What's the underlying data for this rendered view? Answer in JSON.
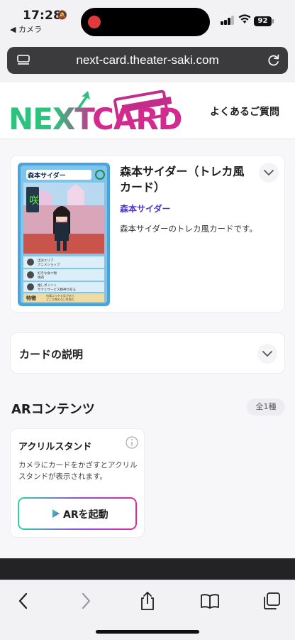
{
  "status_bar": {
    "time": "17:28",
    "back_label": "◀ カメラ",
    "battery": "92"
  },
  "browser": {
    "url": "next-card.theater-saki.com"
  },
  "site": {
    "logo_text": "NEXTCARD",
    "faq_label": "よくあるご質問"
  },
  "card": {
    "title": "森本サイダー（トレカ風カード）",
    "author": "森本サイダー",
    "description": "森本サイダーのトレカ風カードです。",
    "image": {
      "name_label": "森本サイダー",
      "row1_label": "出没エリア",
      "row1_value": "アニメショップ",
      "row2_label": "好きな食べ物",
      "row2_value": "焼肉",
      "row3_label": "推しポイント",
      "row3_value": "サクとサービス精神がある",
      "feature_label": "特徴",
      "feature_line1": "何事よりやる気があり",
      "feature_line2": "どこか憎めない性格だ"
    }
  },
  "description_section": {
    "label": "カードの説明"
  },
  "ar_section": {
    "title": "ARコンテンツ",
    "count": "全1種",
    "items": [
      {
        "title": "アクリルスタンド",
        "description": "カメラにカードをかざすとアクリルスタンドが表示されます。",
        "button_label": "ARを起動"
      }
    ]
  },
  "colors": {
    "accent_purple": "#4d33c7",
    "logo_green": "#2ec27e",
    "logo_magenta": "#d42a8f",
    "button_gradient_start": "#2ed3a0",
    "button_gradient_end": "#e0289c"
  },
  "toolbar": {
    "icons": [
      "back-icon",
      "forward-icon",
      "share-icon",
      "bookmarks-icon",
      "tabs-icon"
    ]
  }
}
